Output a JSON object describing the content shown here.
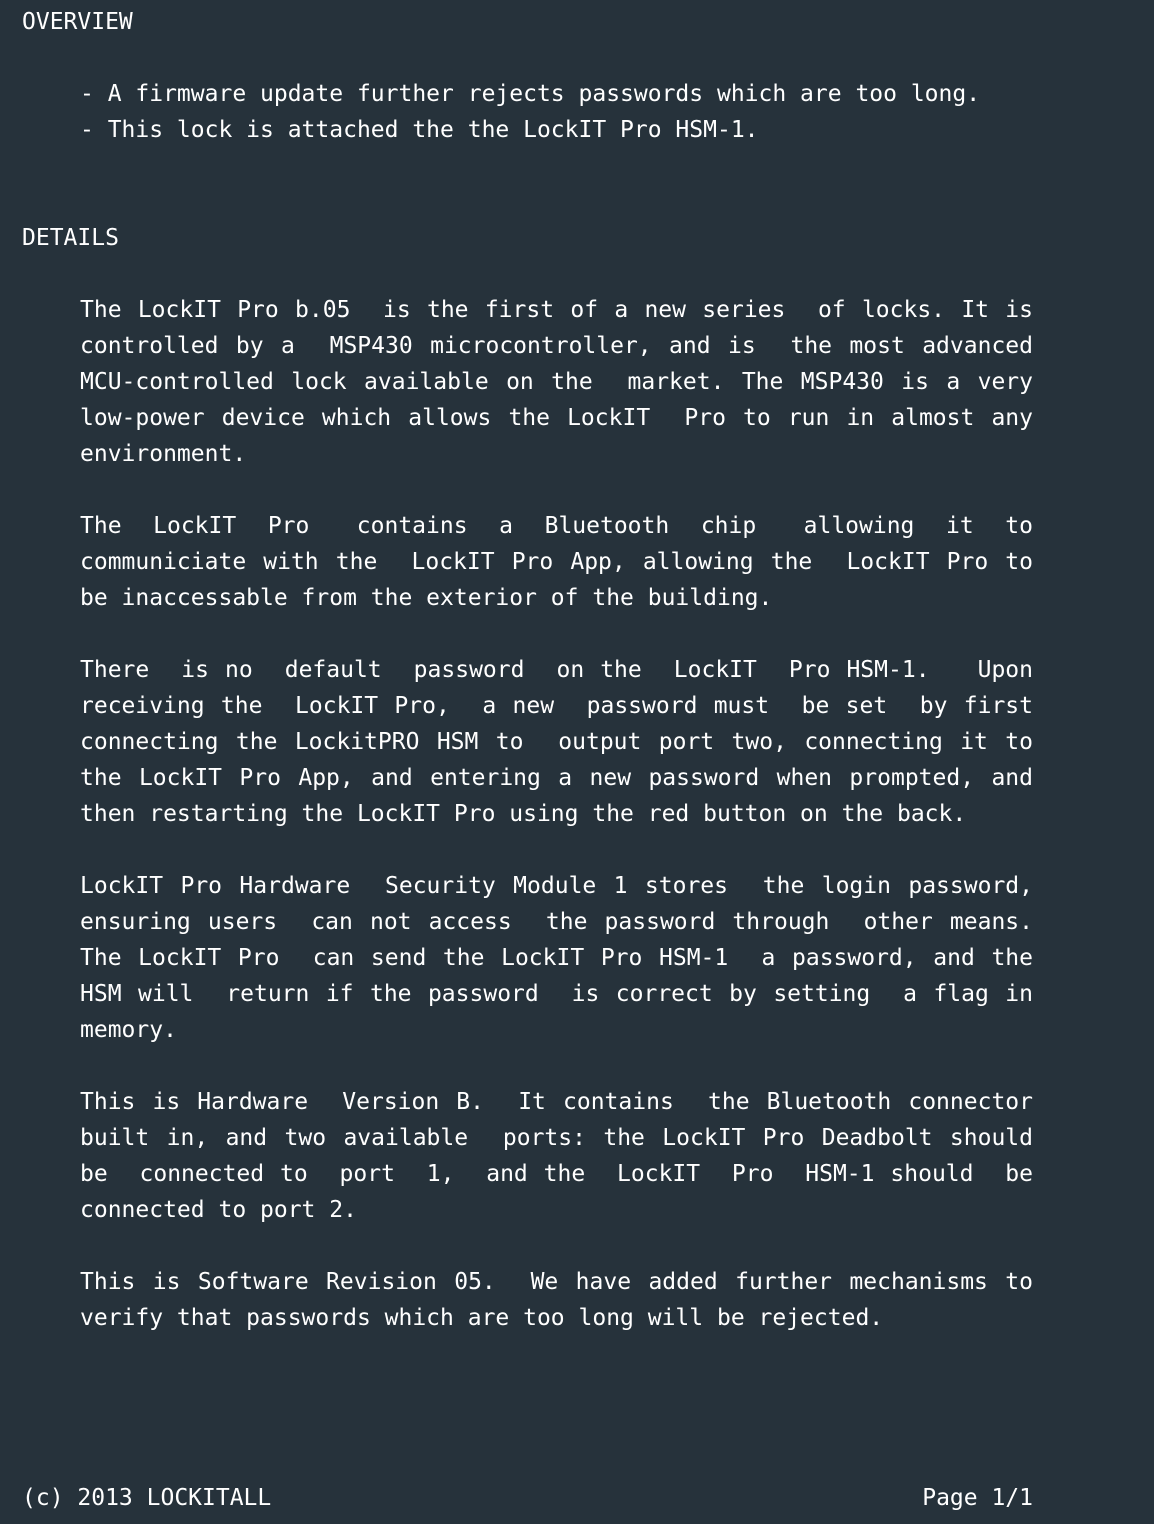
{
  "overview": {
    "heading": "OVERVIEW",
    "items": [
      "- A firmware update further rejects passwords which are too long.",
      "- This lock is attached the the LockIT Pro HSM-1."
    ]
  },
  "details": {
    "heading": "DETAILS",
    "paragraphs": [
      "The LockIT Pro b.05  is the first of a new series  of locks. It is controlled by a  MSP430 microcontroller, and is  the most advanced MCU-controlled lock available on the  market. The MSP430 is a very low-power device which allows the LockIT  Pro to run in almost any environment.",
      "The  LockIT  Pro   contains  a  Bluetooth  chip   allowing  it  to communiciate with the  LockIT Pro App, allowing the  LockIT Pro to be inaccessable from the exterior of the building.",
      "There  is no  default  password  on the  LockIT  Pro HSM-1.   Upon receiving the  LockIT Pro,  a new  password must  be set  by first connecting the LockitPRO HSM to  output port two, connecting it to the LockIT Pro App, and entering a new password when prompted, and then restarting the LockIT Pro using the red button on the back.",
      "LockIT Pro Hardware  Security Module 1 stores  the login password, ensuring users  can not access  the password through  other means. The LockIT Pro  can send the LockIT Pro HSM-1  a password, and the HSM will  return if the password  is correct by setting  a flag in memory.",
      "This is Hardware  Version B.  It contains  the Bluetooth connector built in, and two available  ports: the LockIT Pro Deadbolt should be  connected to  port  1,  and the  LockIT  Pro  HSM-1 should  be connected to port 2.",
      "This is Software Revision 05.  We have added further mechanisms to verify that passwords which are too long will be rejected."
    ]
  },
  "footer": {
    "copyright": "(c) 2013 LOCKITALL",
    "page": "Page 1/1"
  }
}
